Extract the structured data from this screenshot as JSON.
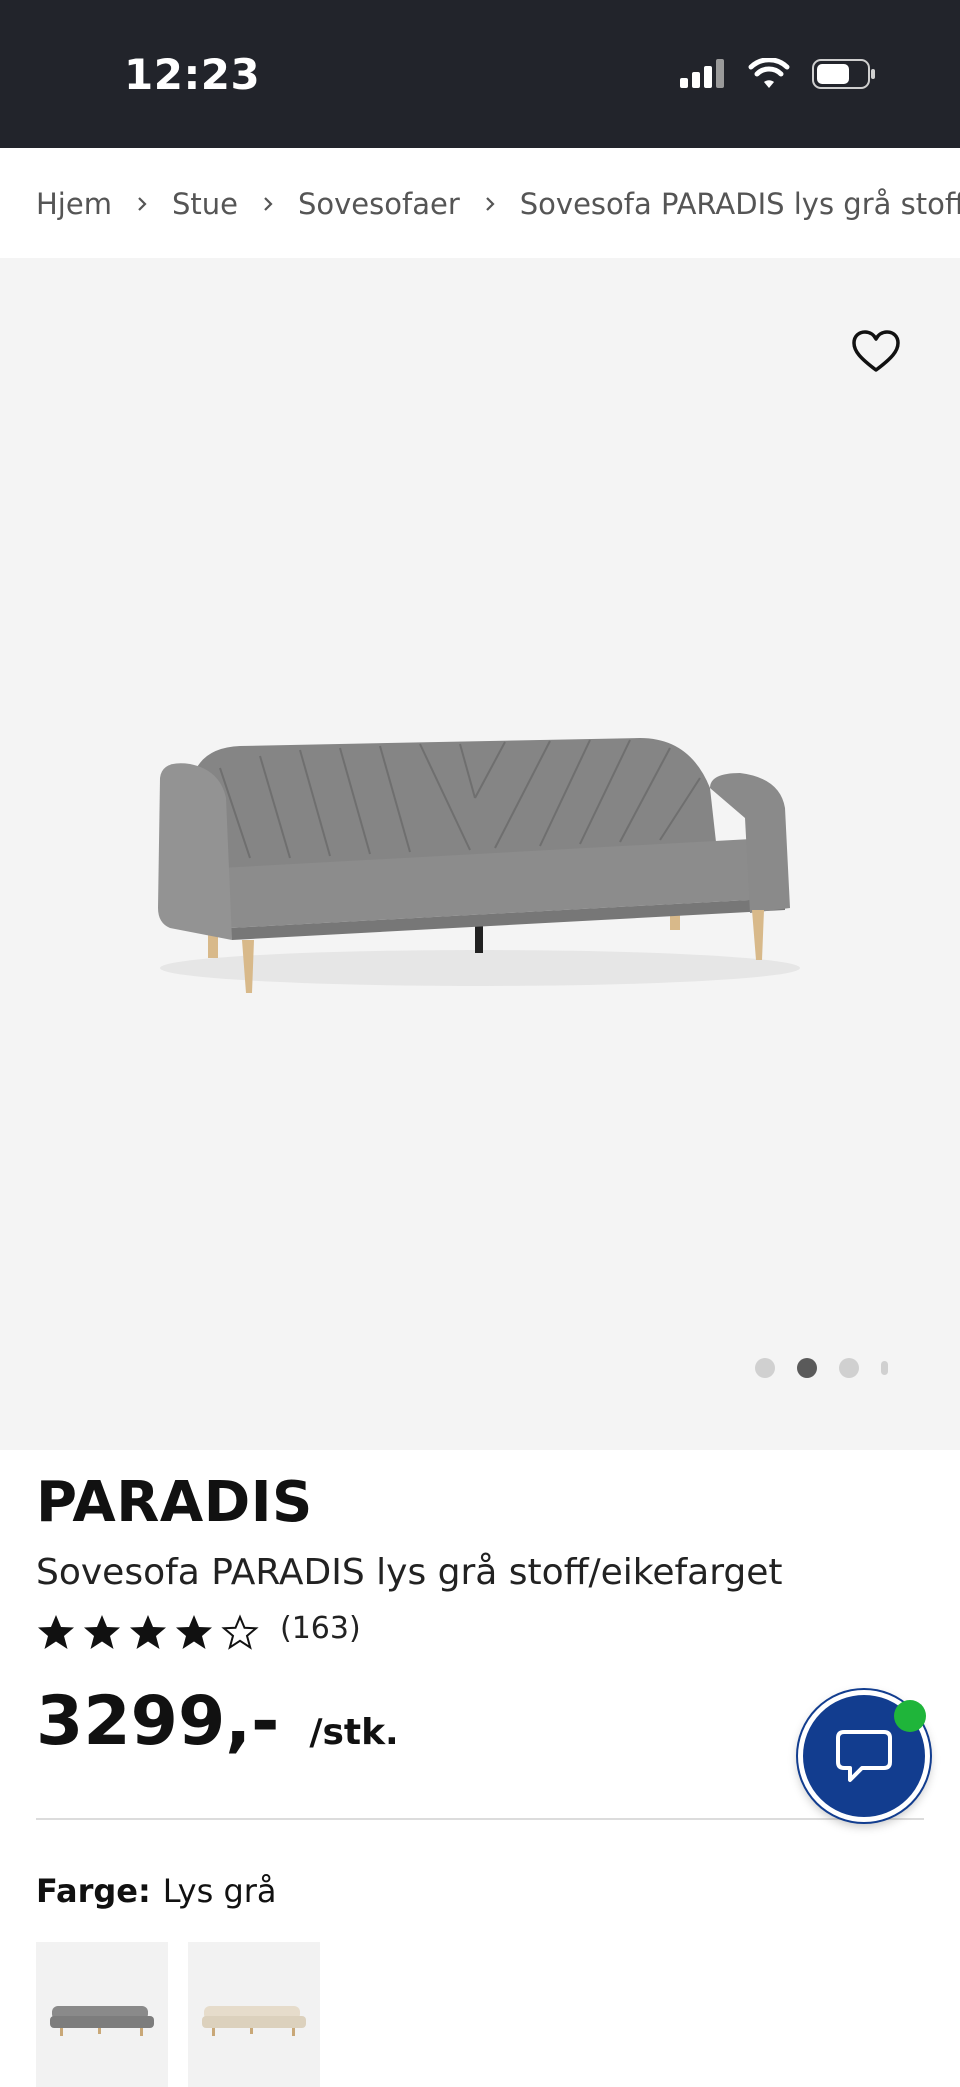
{
  "status_bar": {
    "time": "12:23"
  },
  "breadcrumb": [
    {
      "label": "Hjem"
    },
    {
      "label": "Stue"
    },
    {
      "label": "Sovesofaer"
    },
    {
      "label": "Sovesofa PARADIS lys grå stoff/eik"
    }
  ],
  "gallery": {
    "active_index": 1,
    "count_visible": 4
  },
  "product": {
    "brand": "PARADIS",
    "title": "Sovesofa PARADIS lys grå stoff/eikefarget",
    "rating_stars": 4,
    "rating_max": 5,
    "review_count": "(163)",
    "price": "3299,-",
    "unit": "/stk."
  },
  "color": {
    "label": "Farge:",
    "value": "Lys grå",
    "options": [
      {
        "name": "light-grey",
        "hex": "#8a8a8a"
      },
      {
        "name": "beige",
        "hex": "#e6dccb"
      }
    ]
  },
  "colors": {
    "status_bar_bg": "#22242b",
    "chat_bg": "#123d8f",
    "online": "#1fb53a"
  }
}
